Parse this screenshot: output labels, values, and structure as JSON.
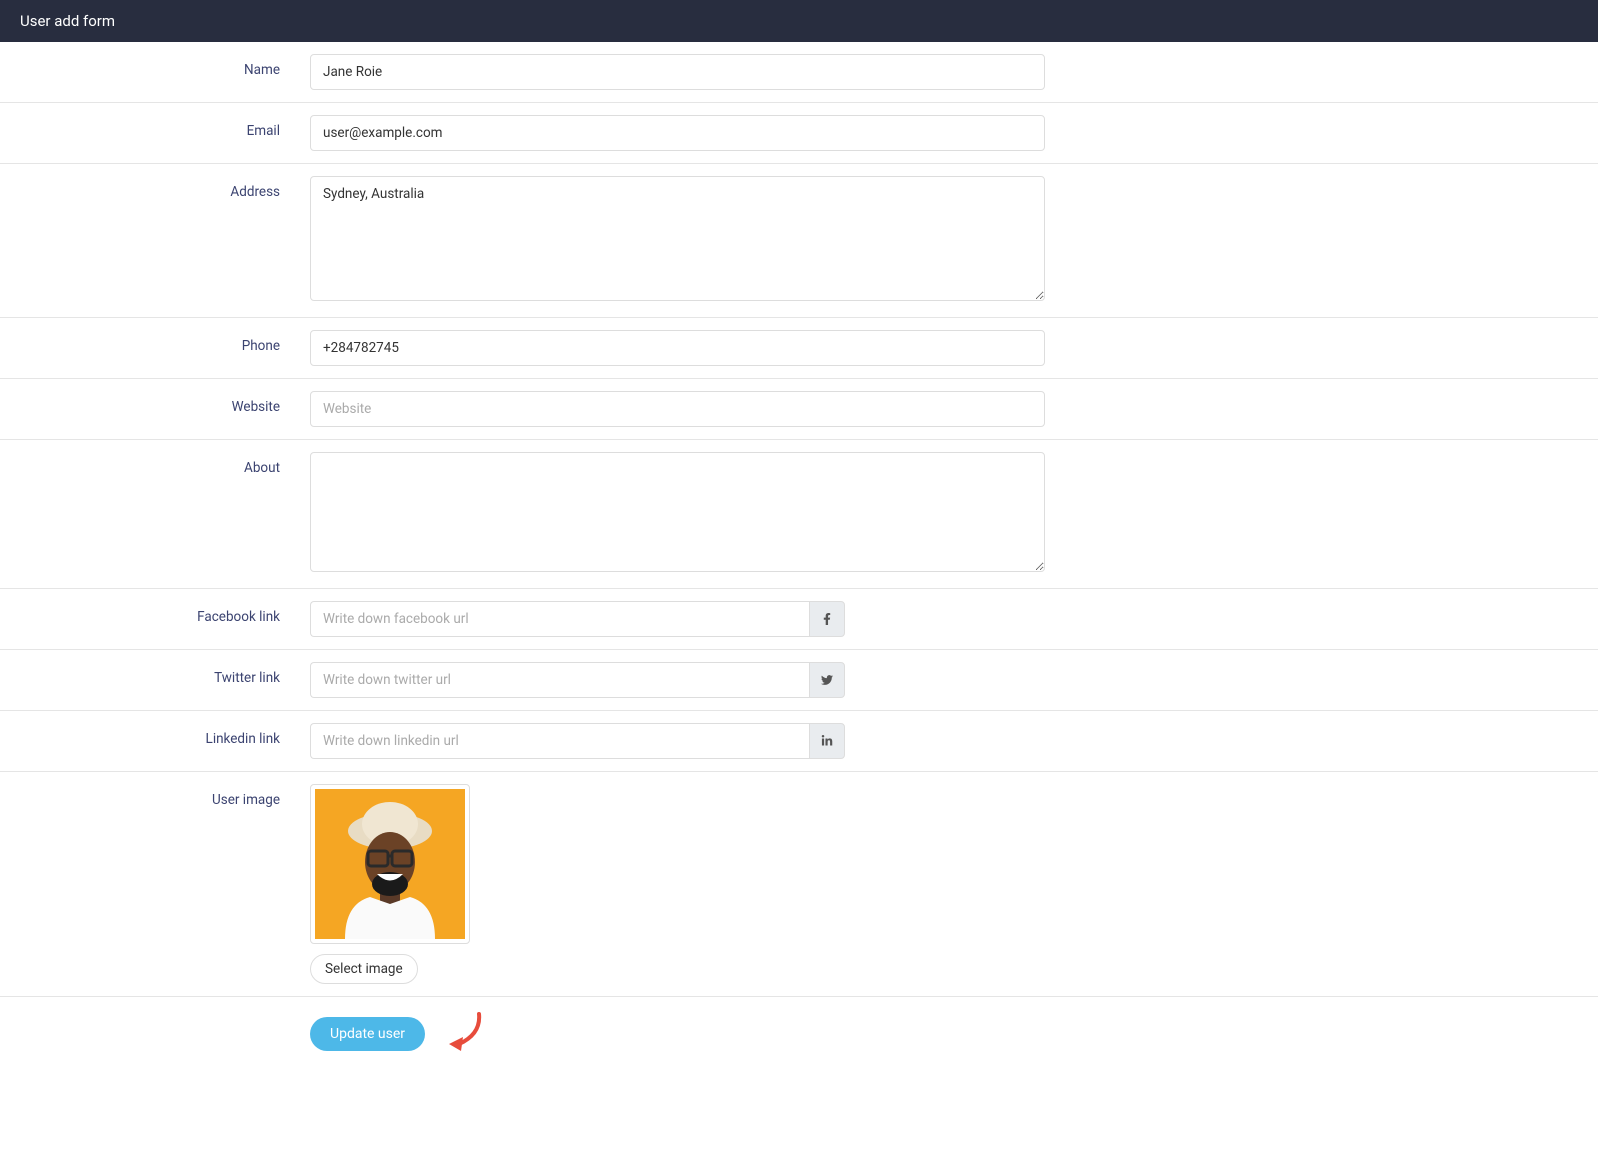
{
  "header": {
    "title": "User add form"
  },
  "form": {
    "name": {
      "label": "Name",
      "value": "Jane Roie"
    },
    "email": {
      "label": "Email",
      "value": "user@example.com"
    },
    "address": {
      "label": "Address",
      "value": "Sydney, Australia"
    },
    "phone": {
      "label": "Phone",
      "value": "+284782745"
    },
    "website": {
      "label": "Website",
      "value": "",
      "placeholder": "Website"
    },
    "about": {
      "label": "About",
      "value": ""
    },
    "facebook": {
      "label": "Facebook link",
      "value": "",
      "placeholder": "Write down facebook url"
    },
    "twitter": {
      "label": "Twitter link",
      "value": "",
      "placeholder": "Write down twitter url"
    },
    "linkedin": {
      "label": "Linkedin link",
      "value": "",
      "placeholder": "Write down linkedin url"
    },
    "image": {
      "label": "User image",
      "select_button": "Select image"
    },
    "submit": {
      "label": "Update user"
    }
  }
}
